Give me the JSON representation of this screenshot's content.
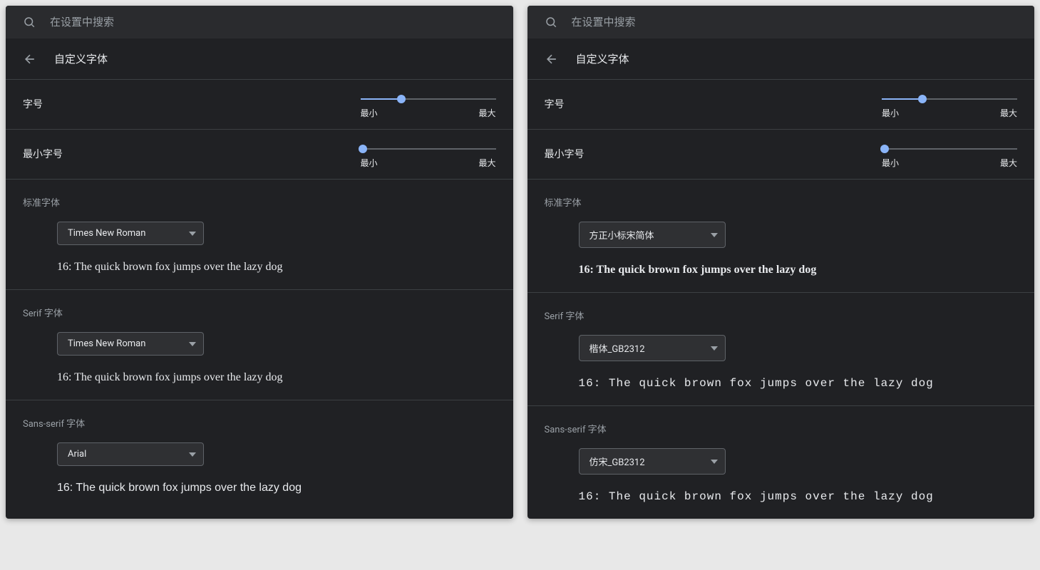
{
  "search_placeholder": "在设置中搜索",
  "page_title": "自定义字体",
  "settings": {
    "font_size": {
      "label": "字号",
      "min_label": "最小",
      "max_label": "最大",
      "percent": 30
    },
    "min_font_size": {
      "label": "最小字号",
      "min_label": "最小",
      "max_label": "最大",
      "percent": 2
    }
  },
  "left": {
    "standard": {
      "heading": "标准字体",
      "selected": "Times New Roman",
      "preview": "16: The quick brown fox jumps over the lazy dog"
    },
    "serif": {
      "heading": "Serif 字体",
      "selected": "Times New Roman",
      "preview": "16: The quick brown fox jumps over the lazy dog"
    },
    "sans": {
      "heading": "Sans-serif 字体",
      "selected": "Arial",
      "preview": "16: The quick brown fox jumps over the lazy dog"
    }
  },
  "right": {
    "standard": {
      "heading": "标准字体",
      "selected": "方正小标宋简体",
      "preview": "16: The quick brown fox jumps over the lazy dog"
    },
    "serif": {
      "heading": "Serif 字体",
      "selected": "楷体_GB2312",
      "preview": "16: The quick brown fox jumps over the lazy dog"
    },
    "sans": {
      "heading": "Sans-serif 字体",
      "selected": "仿宋_GB2312",
      "preview": "16: The quick brown fox jumps over the lazy dog"
    }
  }
}
